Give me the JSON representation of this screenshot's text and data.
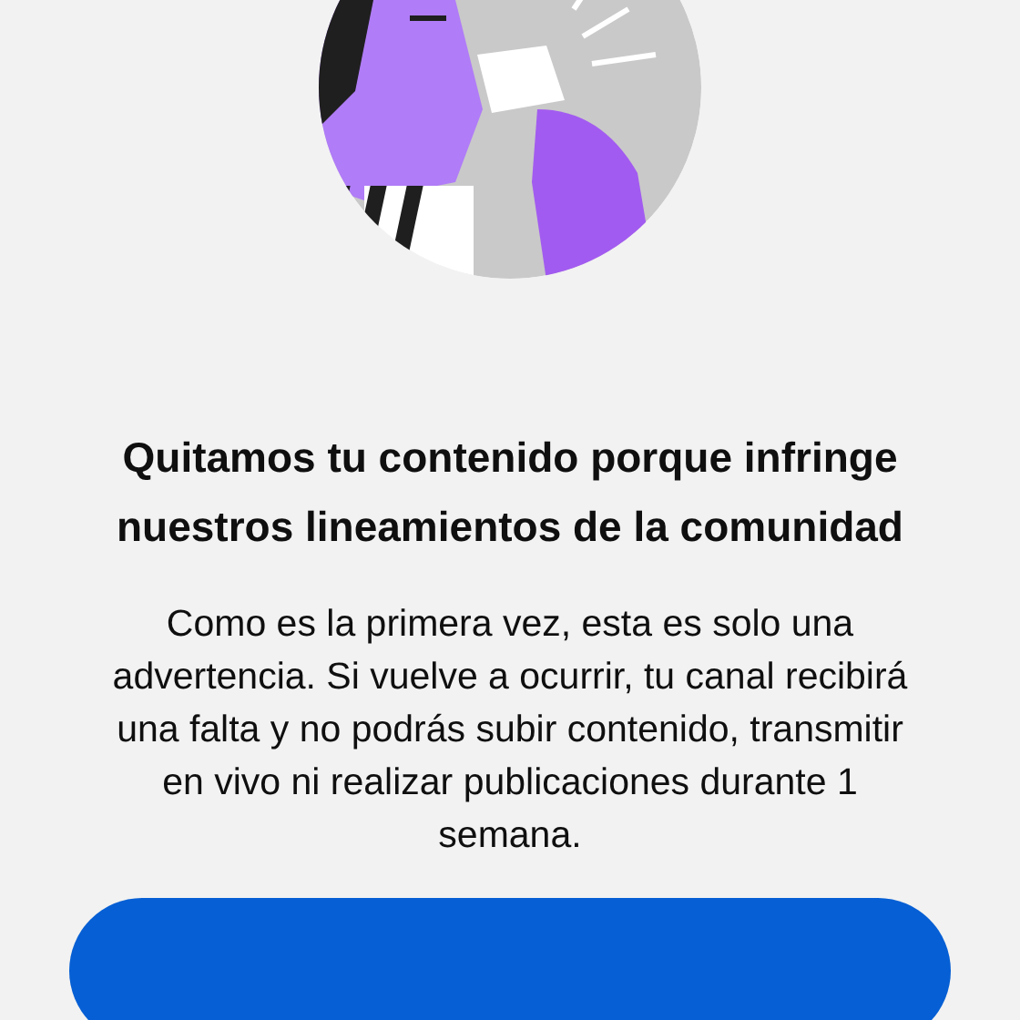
{
  "title": "Quitamos tu contenido porque infringe nuestros lineamientos de la comunidad",
  "message": "Como es la primera vez, esta es solo una advertencia. Si vuelve a ocurrir, tu canal recibirá una falta y no podrás subir contenido, transmitir en vivo ni realizar publicaciones durante 1 semana."
}
